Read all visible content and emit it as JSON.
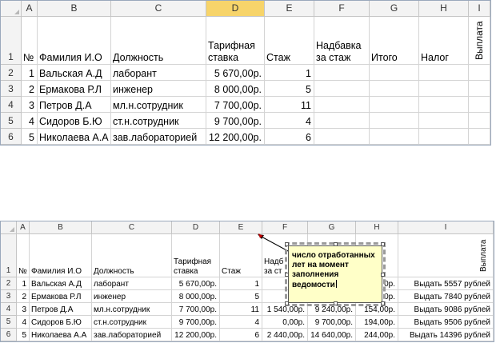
{
  "sheet1": {
    "columns": [
      "A",
      "B",
      "C",
      "D",
      "E",
      "F",
      "G",
      "H",
      "I"
    ],
    "rows": [
      "1",
      "2",
      "3",
      "4",
      "5",
      "6"
    ],
    "headers": {
      "num": "№",
      "name": "Фамилия И.О",
      "position": "Должность",
      "rate_l1": "Тарифная",
      "rate_l2": "ставка",
      "experience": "Стаж",
      "bonus_l1": "Надбавка",
      "bonus_l2": "за стаж",
      "total": "Итого",
      "tax": "Налог",
      "payout": "Выплата"
    },
    "data": [
      {
        "num": "1",
        "name": "Вальская А.Д",
        "position": "лаборант",
        "rate": "5 670,00р.",
        "exp": "1"
      },
      {
        "num": "2",
        "name": "Ермакова Р.Л",
        "position": "инженер",
        "rate": "8 000,00р.",
        "exp": "5"
      },
      {
        "num": "3",
        "name": "Петров Д.А",
        "position": "мл.н.сотрудник",
        "rate": "7 700,00р.",
        "exp": "11"
      },
      {
        "num": "4",
        "name": "Сидоров Б.Ю",
        "position": "ст.н.сотрудник",
        "rate": "9 700,00р.",
        "exp": "4"
      },
      {
        "num": "5",
        "name": "Николаева А.А",
        "position": "зав.лабораторией",
        "rate": "12 200,00р.",
        "exp": "6"
      }
    ]
  },
  "sheet2": {
    "columns": [
      "A",
      "B",
      "C",
      "D",
      "E",
      "F",
      "G",
      "H",
      "I"
    ],
    "rows": [
      "1",
      "2",
      "3",
      "4",
      "5",
      "6"
    ],
    "headers": {
      "num": "№",
      "name": "Фамилия И.О",
      "position": "Должность",
      "rate_l1": "Тарифная",
      "rate_l2": "ставка",
      "experience": "Стаж",
      "bonus_l1": "Надб",
      "bonus_l2": "за ст",
      "payout": "Выплата"
    },
    "data": [
      {
        "num": "1",
        "name": "Вальская А.Д",
        "position": "лаборант",
        "rate": "5 670,00р.",
        "exp": "1",
        "bonus": "",
        "total": "",
        "tax": "0р.",
        "payout": "Выдать 5557 рублей"
      },
      {
        "num": "2",
        "name": "Ермакова Р.Л",
        "position": "инженер",
        "rate": "8 000,00р.",
        "exp": "5",
        "bonus": "",
        "total": "",
        "tax": "0р.",
        "payout": "Выдать 7840 рублей"
      },
      {
        "num": "3",
        "name": "Петров Д.А",
        "position": "мл.н.сотрудник",
        "rate": "7 700,00р.",
        "exp": "11",
        "bonus": "1 540,00р.",
        "total": "9 240,00р.",
        "tax": "154,00р.",
        "payout": "Выдать 9086 рублей"
      },
      {
        "num": "4",
        "name": "Сидоров Б.Ю",
        "position": "ст.н.сотрудник",
        "rate": "9 700,00р.",
        "exp": "4",
        "bonus": "0,00р.",
        "total": "9 700,00р.",
        "tax": "194,00р.",
        "payout": "Выдать 9506 рублей"
      },
      {
        "num": "5",
        "name": "Николаева А.А",
        "position": "зав.лабораторией",
        "rate": "12 200,00р.",
        "exp": "6",
        "bonus": "2 440,00р.",
        "total": "14 640,00р.",
        "tax": "244,00р.",
        "payout": "Выдать 14396 рублей"
      }
    ],
    "comment_text": "число отработанных\nлет на момент\nзаполнения\nведомости"
  },
  "colors": {
    "header_bg": "#f3f3f3",
    "selected_header": "#f7d46a",
    "comment_bg": "#ffffc8",
    "gridline": "#d4d4d4"
  }
}
